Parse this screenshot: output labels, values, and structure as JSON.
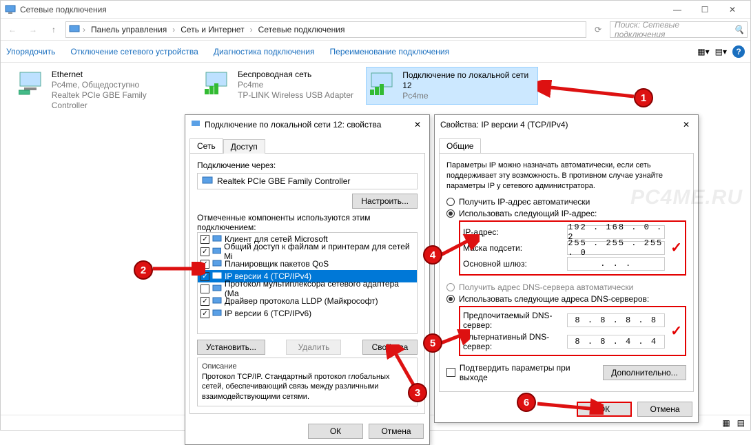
{
  "window": {
    "title": "Сетевые подключения",
    "breadcrumb": [
      "Панель управления",
      "Сеть и Интернет",
      "Сетевые подключения"
    ],
    "search_placeholder": "Поиск: Сетевые подключения"
  },
  "toolbar": {
    "organize": "Упорядочить",
    "disable": "Отключение сетевого устройства",
    "diagnose": "Диагностика подключения",
    "rename": "Переименование подключения"
  },
  "connections": [
    {
      "name": "Ethernet",
      "sub1": "Pc4me, Общедоступно",
      "sub2": "Realtek PCIe GBE Family Controller"
    },
    {
      "name": "Беспроводная сеть",
      "sub1": "Pc4me",
      "sub2": "TP-LINK Wireless USB Adapter"
    },
    {
      "name": "Подключение по локальной сети 12",
      "sub1": "Pc4me",
      "sub2": ""
    }
  ],
  "propsDialog": {
    "title": "Подключение по локальной сети 12: свойства",
    "tab_net": "Сеть",
    "tab_access": "Доступ",
    "connect_via_label": "Подключение через:",
    "adapter": "Realtek PCIe GBE Family Controller",
    "configure": "Настроить...",
    "components_label": "Отмеченные компоненты используются этим подключением:",
    "components": [
      {
        "checked": true,
        "label": "Клиент для сетей Microsoft"
      },
      {
        "checked": true,
        "label": "Общий доступ к файлам и принтерам для сетей Mi"
      },
      {
        "checked": true,
        "label": "Планировщик пакетов QoS"
      },
      {
        "checked": true,
        "label": "IP версии 4 (TCP/IPv4)",
        "selected": true
      },
      {
        "checked": false,
        "label": "Протокол мультиплексора сетевого адаптера (Ма"
      },
      {
        "checked": true,
        "label": "Драйвер протокола LLDP (Майкрософт)"
      },
      {
        "checked": true,
        "label": "IP версии 6 (TCP/IPv6)"
      }
    ],
    "install": "Установить...",
    "remove": "Удалить",
    "properties": "Свойства",
    "desc_label": "Описание",
    "desc_text": "Протокол TCP/IP. Стандартный протокол глобальных сетей, обеспечивающий связь между различными взаимодействующими сетями.",
    "ok": "ОК",
    "cancel": "Отмена"
  },
  "ipv4Dialog": {
    "title": "Свойства: IP версии 4 (TCP/IPv4)",
    "tab_general": "Общие",
    "intro": "Параметры IP можно назначать автоматически, если сеть поддерживает эту возможность. В противном случае узнайте параметры IP у сетевого администратора.",
    "auto_ip": "Получить IP-адрес автоматически",
    "use_ip": "Использовать следующий IP-адрес:",
    "ip_label": "IP-адрес:",
    "ip_value": "192 . 168 .  0  .  2",
    "mask_label": "Маска подсети:",
    "mask_value": "255 . 255 . 255 .  0",
    "gateway_label": "Основной шлюз:",
    "gateway_value": " .       .       . ",
    "auto_dns": "Получить адрес DNS-сервера автоматически",
    "use_dns": "Использовать следующие адреса DNS-серверов:",
    "dns1_label": "Предпочитаемый DNS-сервер:",
    "dns1_value": "8  .  8  .  8  .  8",
    "dns2_label": "Альтернативный DNS-сервер:",
    "dns2_value": "8  .  8  .  4  .  4",
    "validate": "Подтвердить параметры при выходе",
    "advanced": "Дополнительно...",
    "ok": "ОК",
    "cancel": "Отмена"
  },
  "watermark": "PC4ME.RU"
}
